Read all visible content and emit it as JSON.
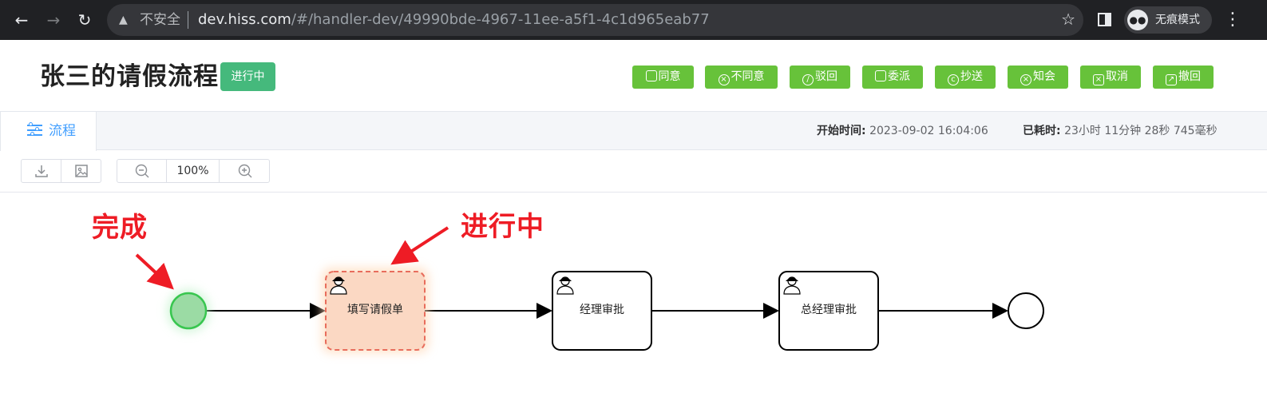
{
  "browser": {
    "security_label": "不安全",
    "url_host": "dev.hiss.com",
    "url_path": "/#/handler-dev/49990bde-4967-11ee-a5f1-4c1d965eab77",
    "incognito_label": "无痕模式"
  },
  "header": {
    "title": "张三的请假流程",
    "status": "进行中",
    "status_color": "#45b97c"
  },
  "actions": [
    {
      "label": "同意",
      "icon": "stamp-icon"
    },
    {
      "label": "不同意",
      "icon": "circle-x-icon"
    },
    {
      "label": "驳回",
      "icon": "eye-off-icon"
    },
    {
      "label": "委派",
      "icon": "delegate-icon"
    },
    {
      "label": "抄送",
      "icon": "cc-icon"
    },
    {
      "label": "知会",
      "icon": "circle-x-icon"
    },
    {
      "label": "取消",
      "icon": "backspace-icon"
    },
    {
      "label": "撤回",
      "icon": "edit-out-icon"
    }
  ],
  "action_color": "#67c23a",
  "tabs": [
    {
      "label": "流程",
      "icon": "sliders-icon",
      "active": true
    }
  ],
  "meta": {
    "start_label": "开始时间:",
    "start_value": "2023-09-02 16:04:06",
    "elapsed_label": "已耗时:",
    "elapsed_value": "23小时 11分钟 28秒 745毫秒"
  },
  "toolbar": {
    "zoom": "100%"
  },
  "diagram": {
    "tasks": [
      {
        "label": "填写请假单",
        "state": "active"
      },
      {
        "label": "经理审批",
        "state": "pending"
      },
      {
        "label": "总经理审批",
        "state": "pending"
      }
    ],
    "annotations": {
      "done": "完成",
      "in_progress": "进行中"
    },
    "annotation_color": "#ee1c25"
  }
}
